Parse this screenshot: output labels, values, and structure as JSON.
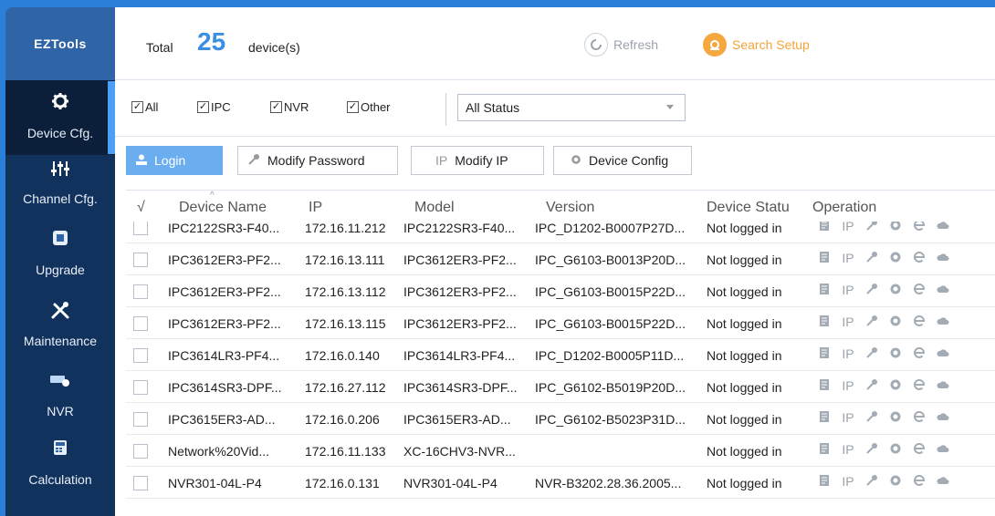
{
  "app": {
    "logo": "EZTools"
  },
  "sidebar": {
    "items": [
      {
        "label": "Device Cfg.",
        "icon": "gear-icon"
      },
      {
        "label": "Channel Cfg.",
        "icon": "sliders-icon"
      },
      {
        "label": "Upgrade",
        "icon": "upgrade-icon"
      },
      {
        "label": "Maintenance",
        "icon": "tools-icon"
      },
      {
        "label": "NVR",
        "icon": "nvr-icon"
      },
      {
        "label": "Calculation",
        "icon": "calculator-icon"
      }
    ]
  },
  "header": {
    "total_label": "Total",
    "total_count": "25",
    "devices_label": "device(s)",
    "refresh_label": "Refresh",
    "search_setup_label": "Search Setup"
  },
  "filters": {
    "checkboxes": [
      {
        "label": "All",
        "checked": true
      },
      {
        "label": "IPC",
        "checked": true
      },
      {
        "label": "NVR",
        "checked": true
      },
      {
        "label": "Other",
        "checked": true
      }
    ],
    "status_select": "All Status"
  },
  "actions": {
    "login": "Login",
    "modify_password": "Modify Password",
    "modify_ip": "Modify IP",
    "device_config": "Device Config",
    "ip_glyph": "IP"
  },
  "table": {
    "check_header": "√",
    "columns": [
      "Device Name",
      "IP",
      "Model",
      "Version",
      "Device Statu",
      "Operation"
    ],
    "op_ip": "IP",
    "rows": [
      {
        "name": "IPC2122SR3-F40...",
        "ip": "172.16.11.212",
        "model": "IPC2122SR3-F40...",
        "version": "IPC_D1202-B0007P27D...",
        "status": "Not logged in"
      },
      {
        "name": "IPC3612ER3-PF2...",
        "ip": "172.16.13.111",
        "model": "IPC3612ER3-PF2...",
        "version": "IPC_G6103-B0013P20D...",
        "status": "Not logged in"
      },
      {
        "name": "IPC3612ER3-PF2...",
        "ip": "172.16.13.112",
        "model": "IPC3612ER3-PF2...",
        "version": "IPC_G6103-B0015P22D...",
        "status": "Not logged in"
      },
      {
        "name": "IPC3612ER3-PF2...",
        "ip": "172.16.13.115",
        "model": "IPC3612ER3-PF2...",
        "version": "IPC_G6103-B0015P22D...",
        "status": "Not logged in"
      },
      {
        "name": "IPC3614LR3-PF4...",
        "ip": "172.16.0.140",
        "model": "IPC3614LR3-PF4...",
        "version": "IPC_D1202-B0005P11D...",
        "status": "Not logged in"
      },
      {
        "name": "IPC3614SR3-DPF...",
        "ip": "172.16.27.112",
        "model": "IPC3614SR3-DPF...",
        "version": "IPC_G6102-B5019P20D...",
        "status": "Not logged in"
      },
      {
        "name": "IPC3615ER3-AD...",
        "ip": "172.16.0.206",
        "model": "IPC3615ER3-AD...",
        "version": "IPC_G6102-B5023P31D...",
        "status": "Not logged in"
      },
      {
        "name": "Network%20Vid...",
        "ip": "172.16.11.133",
        "model": "XC-16CHV3-NVR...",
        "version": "",
        "status": "Not logged in"
      },
      {
        "name": "NVR301-04L-P4",
        "ip": "172.16.0.131",
        "model": "NVR301-04L-P4",
        "version": "NVR-B3202.28.36.2005...",
        "status": "Not logged in"
      }
    ]
  }
}
